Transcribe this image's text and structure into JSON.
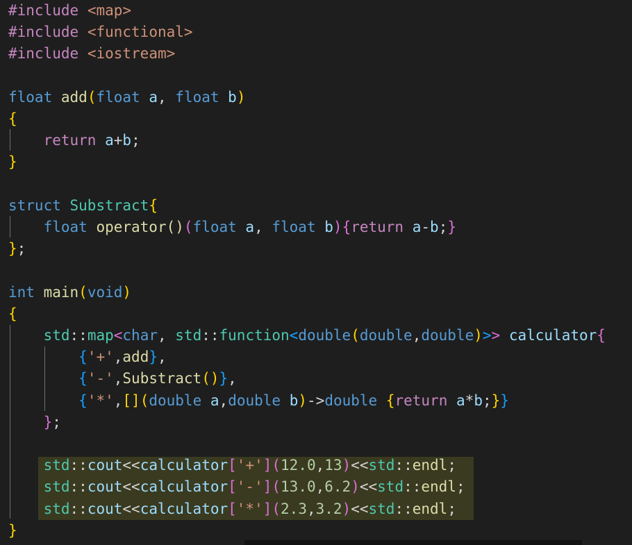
{
  "editor": {
    "colors": {
      "background": "#1e1e1e",
      "preprocessor": "#c586c0",
      "keyword": "#569cd6",
      "type": "#4ec9b0",
      "function": "#dcdcaa",
      "parameter": "#9cdcfe",
      "string": "#ce9178",
      "number": "#b5cea8",
      "bracket_1": "#ffd700",
      "bracket_2": "#da70d6",
      "bracket_3": "#179fff",
      "selection_highlight": "#3a3a20"
    },
    "highlighted_lines": [
      20,
      21,
      22
    ],
    "lines": [
      {
        "n": 1,
        "tokens": [
          [
            "pp",
            "#include"
          ],
          [
            "op",
            " "
          ],
          [
            "st",
            "<map>"
          ]
        ]
      },
      {
        "n": 2,
        "tokens": [
          [
            "pp",
            "#include"
          ],
          [
            "op",
            " "
          ],
          [
            "st",
            "<functional>"
          ]
        ]
      },
      {
        "n": 3,
        "tokens": [
          [
            "pp",
            "#include"
          ],
          [
            "op",
            " "
          ],
          [
            "st",
            "<iostream>"
          ]
        ]
      },
      {
        "n": 4,
        "tokens": []
      },
      {
        "n": 5,
        "tokens": [
          [
            "kw",
            "float"
          ],
          [
            "op",
            " "
          ],
          [
            "fn",
            "add"
          ],
          [
            "b1",
            "("
          ],
          [
            "kw",
            "float"
          ],
          [
            "op",
            " "
          ],
          [
            "pa",
            "a"
          ],
          [
            "op",
            ", "
          ],
          [
            "kw",
            "float"
          ],
          [
            "op",
            " "
          ],
          [
            "pa",
            "b"
          ],
          [
            "b1",
            ")"
          ]
        ]
      },
      {
        "n": 6,
        "tokens": [
          [
            "b1",
            "{"
          ]
        ]
      },
      {
        "n": 7,
        "tokens": [
          [
            "op",
            "    "
          ],
          [
            "pp",
            "return"
          ],
          [
            "op",
            " "
          ],
          [
            "pa",
            "a"
          ],
          [
            "op",
            "+"
          ],
          [
            "pa",
            "b"
          ],
          [
            "op",
            ";"
          ]
        ]
      },
      {
        "n": 8,
        "tokens": [
          [
            "b1",
            "}"
          ]
        ]
      },
      {
        "n": 9,
        "tokens": []
      },
      {
        "n": 10,
        "tokens": [
          [
            "kw",
            "struct"
          ],
          [
            "op",
            " "
          ],
          [
            "ty",
            "Substract"
          ],
          [
            "b1",
            "{"
          ]
        ]
      },
      {
        "n": 11,
        "tokens": [
          [
            "op",
            "    "
          ],
          [
            "kw",
            "float"
          ],
          [
            "op",
            " "
          ],
          [
            "fn",
            "operator()"
          ],
          [
            "b2",
            "("
          ],
          [
            "kw",
            "float"
          ],
          [
            "op",
            " "
          ],
          [
            "pa",
            "a"
          ],
          [
            "op",
            ", "
          ],
          [
            "kw",
            "float"
          ],
          [
            "op",
            " "
          ],
          [
            "pa",
            "b"
          ],
          [
            "b2",
            ")"
          ],
          [
            "b2",
            "{"
          ],
          [
            "pp",
            "return"
          ],
          [
            "op",
            " "
          ],
          [
            "pa",
            "a"
          ],
          [
            "op",
            "-"
          ],
          [
            "pa",
            "b"
          ],
          [
            "op",
            ";"
          ],
          [
            "b2",
            "}"
          ]
        ]
      },
      {
        "n": 12,
        "tokens": [
          [
            "b1",
            "}"
          ],
          [
            "op",
            ";"
          ]
        ]
      },
      {
        "n": 13,
        "tokens": []
      },
      {
        "n": 14,
        "tokens": [
          [
            "kw",
            "int"
          ],
          [
            "op",
            " "
          ],
          [
            "fn",
            "main"
          ],
          [
            "b1",
            "("
          ],
          [
            "kw",
            "void"
          ],
          [
            "b1",
            ")"
          ]
        ]
      },
      {
        "n": 15,
        "tokens": [
          [
            "b1",
            "{"
          ]
        ]
      },
      {
        "n": 16,
        "tokens": [
          [
            "op",
            "    "
          ],
          [
            "ty",
            "std"
          ],
          [
            "op",
            "::"
          ],
          [
            "ty",
            "map"
          ],
          [
            "b2",
            "<"
          ],
          [
            "kw",
            "char"
          ],
          [
            "op",
            ", "
          ],
          [
            "ty",
            "std"
          ],
          [
            "op",
            "::"
          ],
          [
            "ty",
            "function"
          ],
          [
            "b3",
            "<"
          ],
          [
            "kw",
            "double"
          ],
          [
            "b1",
            "("
          ],
          [
            "kw",
            "double"
          ],
          [
            "op",
            ","
          ],
          [
            "kw",
            "double"
          ],
          [
            "b1",
            ")"
          ],
          [
            "b3",
            ">"
          ],
          [
            "b2",
            ">"
          ],
          [
            "op",
            " "
          ],
          [
            "pa",
            "calculator"
          ],
          [
            "b2",
            "{"
          ]
        ]
      },
      {
        "n": 17,
        "tokens": [
          [
            "op",
            "        "
          ],
          [
            "b3",
            "{"
          ],
          [
            "st",
            "'+'"
          ],
          [
            "op",
            ","
          ],
          [
            "fn",
            "add"
          ],
          [
            "b3",
            "}"
          ],
          [
            "op",
            ","
          ]
        ]
      },
      {
        "n": 18,
        "tokens": [
          [
            "op",
            "        "
          ],
          [
            "b3",
            "{"
          ],
          [
            "st",
            "'-'"
          ],
          [
            "op",
            ","
          ],
          [
            "fn",
            "Substract"
          ],
          [
            "b1",
            "()"
          ],
          [
            "b3",
            "}"
          ],
          [
            "op",
            ","
          ]
        ]
      },
      {
        "n": 19,
        "tokens": [
          [
            "op",
            "        "
          ],
          [
            "b3",
            "{"
          ],
          [
            "st",
            "'*'"
          ],
          [
            "op",
            ","
          ],
          [
            "b1",
            "[]"
          ],
          [
            "b1",
            "("
          ],
          [
            "kw",
            "double"
          ],
          [
            "op",
            " "
          ],
          [
            "pa",
            "a"
          ],
          [
            "op",
            ","
          ],
          [
            "kw",
            "double"
          ],
          [
            "op",
            " "
          ],
          [
            "pa",
            "b"
          ],
          [
            "b1",
            ")"
          ],
          [
            "op",
            "->"
          ],
          [
            "kw",
            "double"
          ],
          [
            "op",
            " "
          ],
          [
            "b1",
            "{"
          ],
          [
            "pp",
            "return"
          ],
          [
            "op",
            " "
          ],
          [
            "pa",
            "a"
          ],
          [
            "op",
            "*"
          ],
          [
            "pa",
            "b"
          ],
          [
            "op",
            ";"
          ],
          [
            "b1",
            "}"
          ],
          [
            "b3",
            "}"
          ]
        ]
      },
      {
        "n": 20,
        "tokens": [
          [
            "op",
            "    "
          ],
          [
            "b2",
            "}"
          ],
          [
            "op",
            ";"
          ]
        ]
      },
      {
        "n": 21,
        "tokens": []
      },
      {
        "n": 22,
        "tokens": [
          [
            "op",
            "    "
          ],
          [
            "ty",
            "std"
          ],
          [
            "op",
            "::"
          ],
          [
            "pa",
            "cout"
          ],
          [
            "op",
            "<<"
          ],
          [
            "pa",
            "calculator"
          ],
          [
            "b2",
            "["
          ],
          [
            "st",
            "'+'"
          ],
          [
            "b2",
            "]"
          ],
          [
            "b2",
            "("
          ],
          [
            "nu",
            "12.0"
          ],
          [
            "op",
            ","
          ],
          [
            "nu",
            "13"
          ],
          [
            "b2",
            ")"
          ],
          [
            "op",
            "<<"
          ],
          [
            "ty",
            "std"
          ],
          [
            "op",
            "::"
          ],
          [
            "fn",
            "endl"
          ],
          [
            "op",
            ";"
          ]
        ]
      },
      {
        "n": 23,
        "tokens": [
          [
            "op",
            "    "
          ],
          [
            "ty",
            "std"
          ],
          [
            "op",
            "::"
          ],
          [
            "pa",
            "cout"
          ],
          [
            "op",
            "<<"
          ],
          [
            "pa",
            "calculator"
          ],
          [
            "b2",
            "["
          ],
          [
            "st",
            "'-'"
          ],
          [
            "b2",
            "]"
          ],
          [
            "b2",
            "("
          ],
          [
            "nu",
            "13.0"
          ],
          [
            "op",
            ","
          ],
          [
            "nu",
            "6.2"
          ],
          [
            "b2",
            ")"
          ],
          [
            "op",
            "<<"
          ],
          [
            "ty",
            "std"
          ],
          [
            "op",
            "::"
          ],
          [
            "fn",
            "endl"
          ],
          [
            "op",
            ";"
          ]
        ]
      },
      {
        "n": 24,
        "tokens": [
          [
            "op",
            "    "
          ],
          [
            "ty",
            "std"
          ],
          [
            "op",
            "::"
          ],
          [
            "pa",
            "cout"
          ],
          [
            "op",
            "<<"
          ],
          [
            "pa",
            "calculator"
          ],
          [
            "b2",
            "["
          ],
          [
            "st",
            "'*'"
          ],
          [
            "b2",
            "]"
          ],
          [
            "b2",
            "("
          ],
          [
            "nu",
            "2.3"
          ],
          [
            "op",
            ","
          ],
          [
            "nu",
            "3.2"
          ],
          [
            "b2",
            ")"
          ],
          [
            "op",
            "<<"
          ],
          [
            "ty",
            "std"
          ],
          [
            "op",
            "::"
          ],
          [
            "fn",
            "endl"
          ],
          [
            "op",
            ";"
          ]
        ]
      },
      {
        "n": 25,
        "tokens": [
          [
            "b1",
            "}"
          ]
        ]
      }
    ]
  }
}
